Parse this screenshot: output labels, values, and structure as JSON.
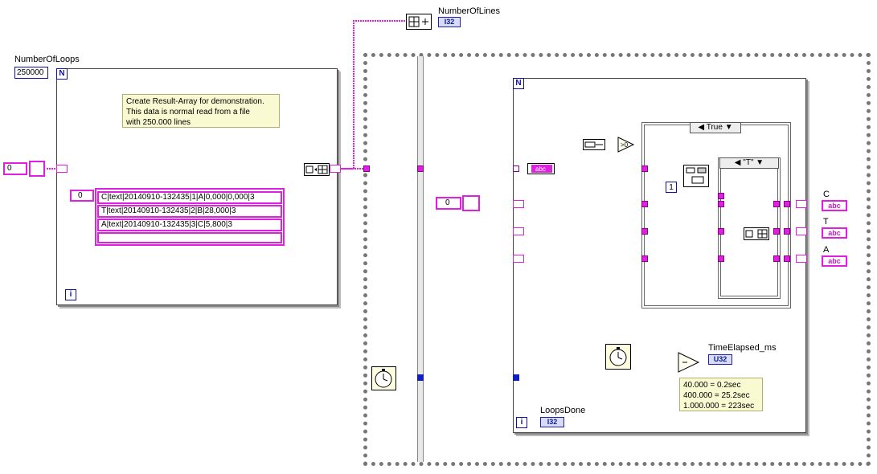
{
  "labels": {
    "number_of_loops": "NumberOfLoops",
    "number_of_lines": "NumberOfLines",
    "time_elapsed": "TimeElapsed_ms",
    "loops_done": "LoopsDone",
    "out_c": "C",
    "out_t": "T",
    "out_a": "A"
  },
  "controls": {
    "number_of_loops_value": "250000",
    "index_0_left": "0",
    "index_0_array": "0",
    "index_0_inner": "0",
    "const_1": "1"
  },
  "types": {
    "i32": "I32",
    "u32": "U32",
    "abc": "abc",
    "loop_n": "N",
    "loop_i": "i"
  },
  "comment": "Create Result-Array for demonstration.\nThis data is normal read from a file\nwith 250.000 lines",
  "timing_note": "40.000 = 0.2sec\n400.000 = 25.2sec\n1.000.000 = 223sec",
  "result_array": [
    "C|text|20140910-132435|1|A|0,000|0,000|3",
    "T|text|20140910-132435|2|B|28,000|3",
    "A|text|20140910-132435|3|C|5,800|3",
    ""
  ],
  "case_outer": "True",
  "case_inner": "\"T\"",
  "colors": {
    "string_wire": "#e020e0",
    "numeric_wire": "#1020c0",
    "frame": "#808080"
  }
}
